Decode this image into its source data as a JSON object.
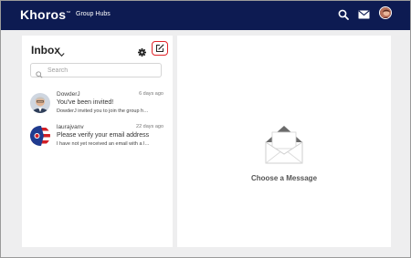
{
  "header": {
    "logo": "Khoros",
    "logo_mark": "™",
    "nav_link": "Group Hubs"
  },
  "inbox": {
    "title": "Inbox",
    "search_placeholder": "Search",
    "messages": [
      {
        "user": "DowderJ",
        "time": "6 days ago",
        "subject": "You've been invited!",
        "preview": "DowderJ invited you to join the group h…"
      },
      {
        "user": "laurajvanv",
        "time": "22 days ago",
        "subject": "Please verify your email address",
        "preview": "I have not yet received an email with a l…"
      }
    ]
  },
  "detail": {
    "empty_message": "Choose a Message"
  },
  "colors": {
    "topbar": "#0d1b52",
    "compose_highlight": "#e0242a"
  }
}
